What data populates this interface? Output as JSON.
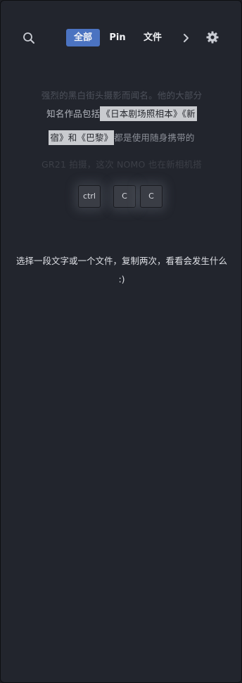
{
  "toolbar": {
    "search_icon": "search-icon",
    "tabs": [
      {
        "label": "全部",
        "active": true
      },
      {
        "label": "Pin",
        "active": false
      },
      {
        "label": "文件",
        "active": false
      }
    ],
    "more_icon": "chevron-right-icon",
    "settings_icon": "gear-icon",
    "accent_color": "#4b73c1"
  },
  "demo": {
    "line1": "强烈的黑白街头摄影而闻名。他的大部分",
    "line2_plain": "知名作品包括",
    "line2_highlight": "《日本剧场照相本》《新",
    "line3_highlight": "宿》和《巴黎》",
    "line3_plain": "都是使用随身携带的",
    "line4": "GR21 拍摄，这次 NOMO 也在新相机搭",
    "keys": [
      "ctrl",
      "C",
      "C"
    ]
  },
  "hint": {
    "text": "选择一段文字或一个文件，复制两次，看看会发生什么 :)"
  }
}
